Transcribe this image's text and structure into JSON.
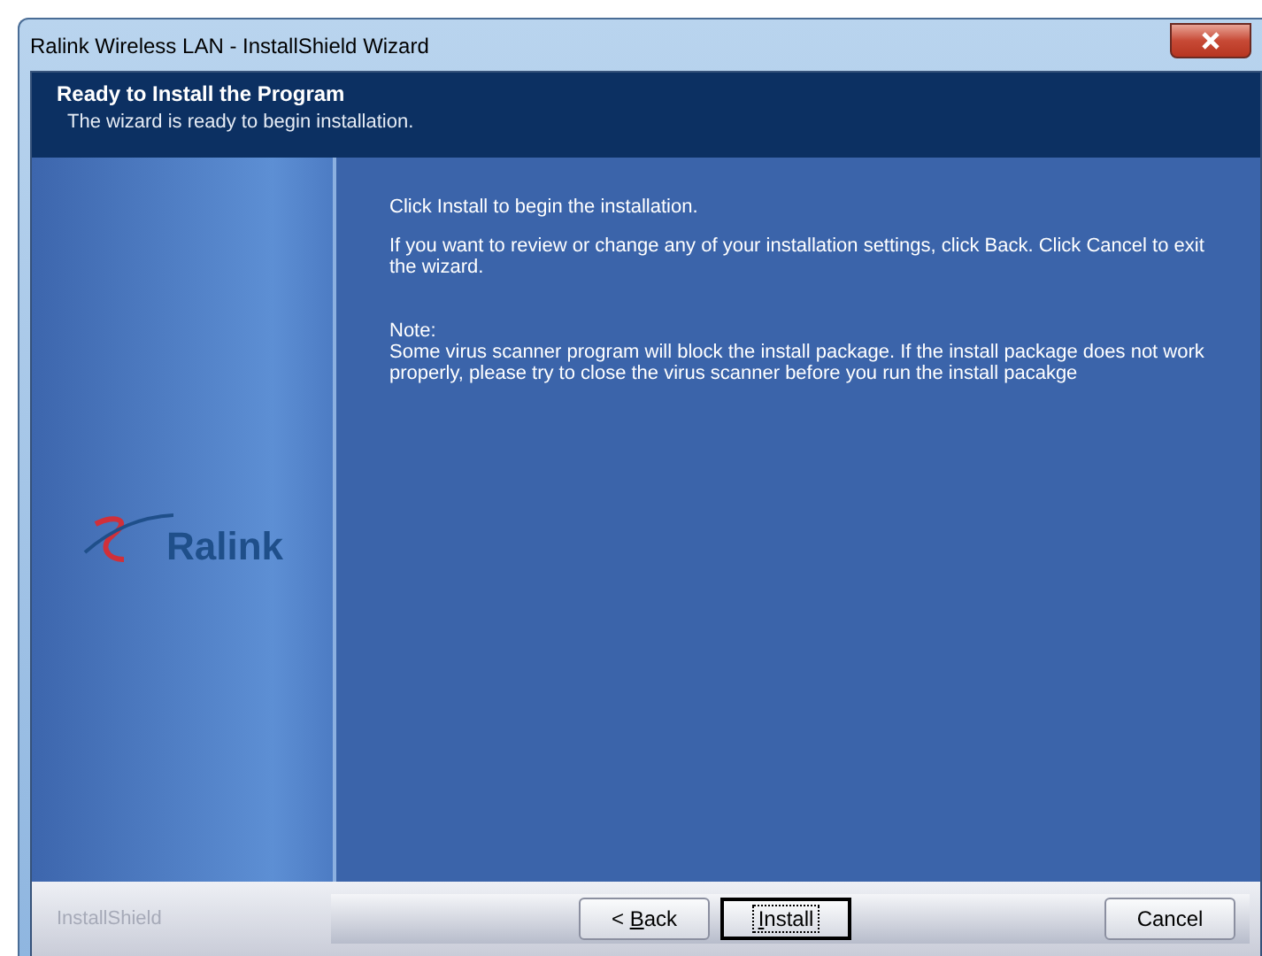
{
  "window": {
    "title": "Ralink Wireless LAN - InstallShield Wizard"
  },
  "header": {
    "title": "Ready to Install the Program",
    "subtitle": "The wizard is ready to begin installation."
  },
  "logo": {
    "text": "Ralink"
  },
  "paragraphs": [
    "Click Install to begin the installation.",
    "If you want to review or change any of your installation settings, click Back. Click Cancel to exit the wizard."
  ],
  "note": {
    "label": "Note:",
    "text": "Some virus scanner program will block the install package. If the install package does not work properly, please try to close the virus scanner before you run the install pacakge"
  },
  "footer": {
    "brand": "InstallShield"
  },
  "buttons": [
    {
      "label_before": "< ",
      "access_key": "B",
      "label_after": "ack",
      "default": false
    },
    {
      "access_key": "I",
      "label_after": "nstall",
      "default": true
    },
    {
      "label_before": "Cancel",
      "default": false
    }
  ]
}
